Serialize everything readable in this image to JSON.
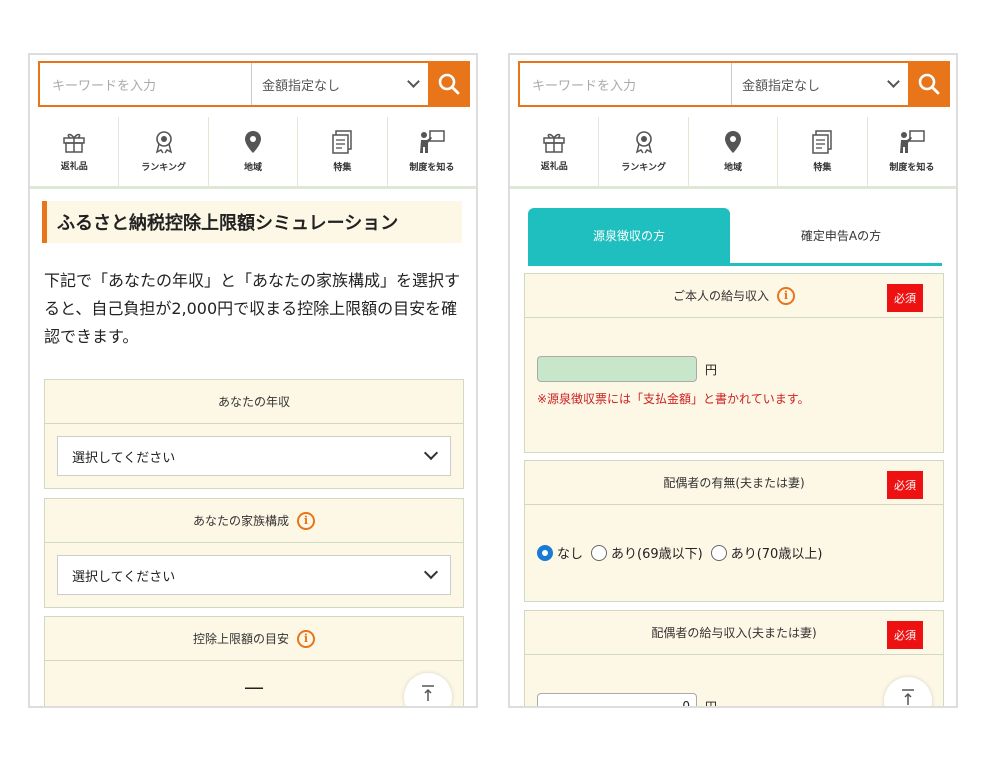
{
  "search": {
    "keyword_placeholder": "キーワードを入力",
    "amount_label": "金額指定なし"
  },
  "nav": [
    {
      "label": "返礼品",
      "icon": "gift-icon"
    },
    {
      "label": "ランキング",
      "icon": "medal-icon"
    },
    {
      "label": "地域",
      "icon": "map-pin-icon"
    },
    {
      "label": "特集",
      "icon": "document-icon"
    },
    {
      "label": "制度を知る",
      "icon": "presenter-icon"
    }
  ],
  "left": {
    "title": "ふるさと納税控除上限額シミュレーション",
    "intro": "下記で「あなたの年収」と「あなたの家族構成」を選択すると、自己負担が2,000円で収まる控除上限額の目安を確認できます。",
    "income_label": "あなたの年収",
    "income_value": "選択してください",
    "family_label": "あなたの家族構成",
    "family_value": "選択してください",
    "limit_label": "控除上限額の目安",
    "limit_value": "—"
  },
  "right": {
    "tabs": [
      "源泉徴収の方",
      "確定申告Aの方"
    ],
    "salary_label": "ご本人の給与収入",
    "required": "必須",
    "unit": "円",
    "salary_note": "※源泉徴収票には「支払金額」と書かれています。",
    "spouse_label": "配偶者の有無(夫または妻)",
    "spouse_options": [
      "なし",
      "あり(69歳以下)",
      "あり(70歳以上)"
    ],
    "spouse_selected": "なし",
    "spouse_income_label": "配偶者の給与収入(夫または妻)",
    "spouse_income_value": "0"
  },
  "info_icon": "i",
  "colors": {
    "accent": "#e8751a",
    "teal": "#1fbfbf",
    "required": "#ee1111",
    "panel_bg": "#fdf7e6"
  }
}
